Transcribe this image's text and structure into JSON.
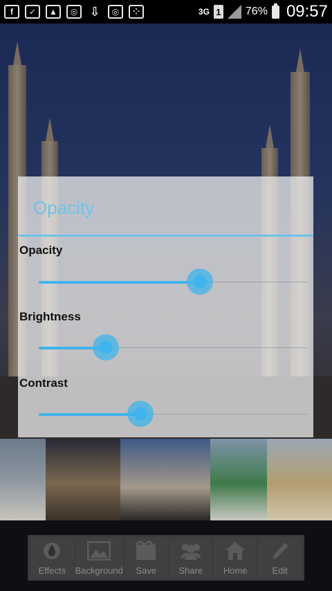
{
  "status_bar": {
    "network": "3G",
    "sim": "1",
    "battery": "76%",
    "time": "09:57",
    "notification_icons": [
      "facebook-icon",
      "document-check-icon",
      "image-icon",
      "instagram-icon",
      "download-icon",
      "instagram-icon",
      "blackberry-messenger-icon"
    ]
  },
  "dialog": {
    "title": "Opacity",
    "sliders": [
      {
        "label": "Opacity",
        "value": 0.6
      },
      {
        "label": "Brightness",
        "value": 0.25
      },
      {
        "label": "Contrast",
        "value": 0.38
      }
    ]
  },
  "toolbar": {
    "items": [
      {
        "label": "Effects",
        "icon": "droplet-icon"
      },
      {
        "label": "Background",
        "icon": "image-icon"
      },
      {
        "label": "Save",
        "icon": "save-board-icon"
      },
      {
        "label": "Share",
        "icon": "share-people-icon"
      },
      {
        "label": "Home",
        "icon": "home-icon"
      },
      {
        "label": "Edit",
        "icon": "pencil-icon"
      }
    ]
  },
  "colors": {
    "accent": "#3fb4ec",
    "dialog_title": "#6fc2e8",
    "toolbar_bg": "#3a3b3d"
  }
}
